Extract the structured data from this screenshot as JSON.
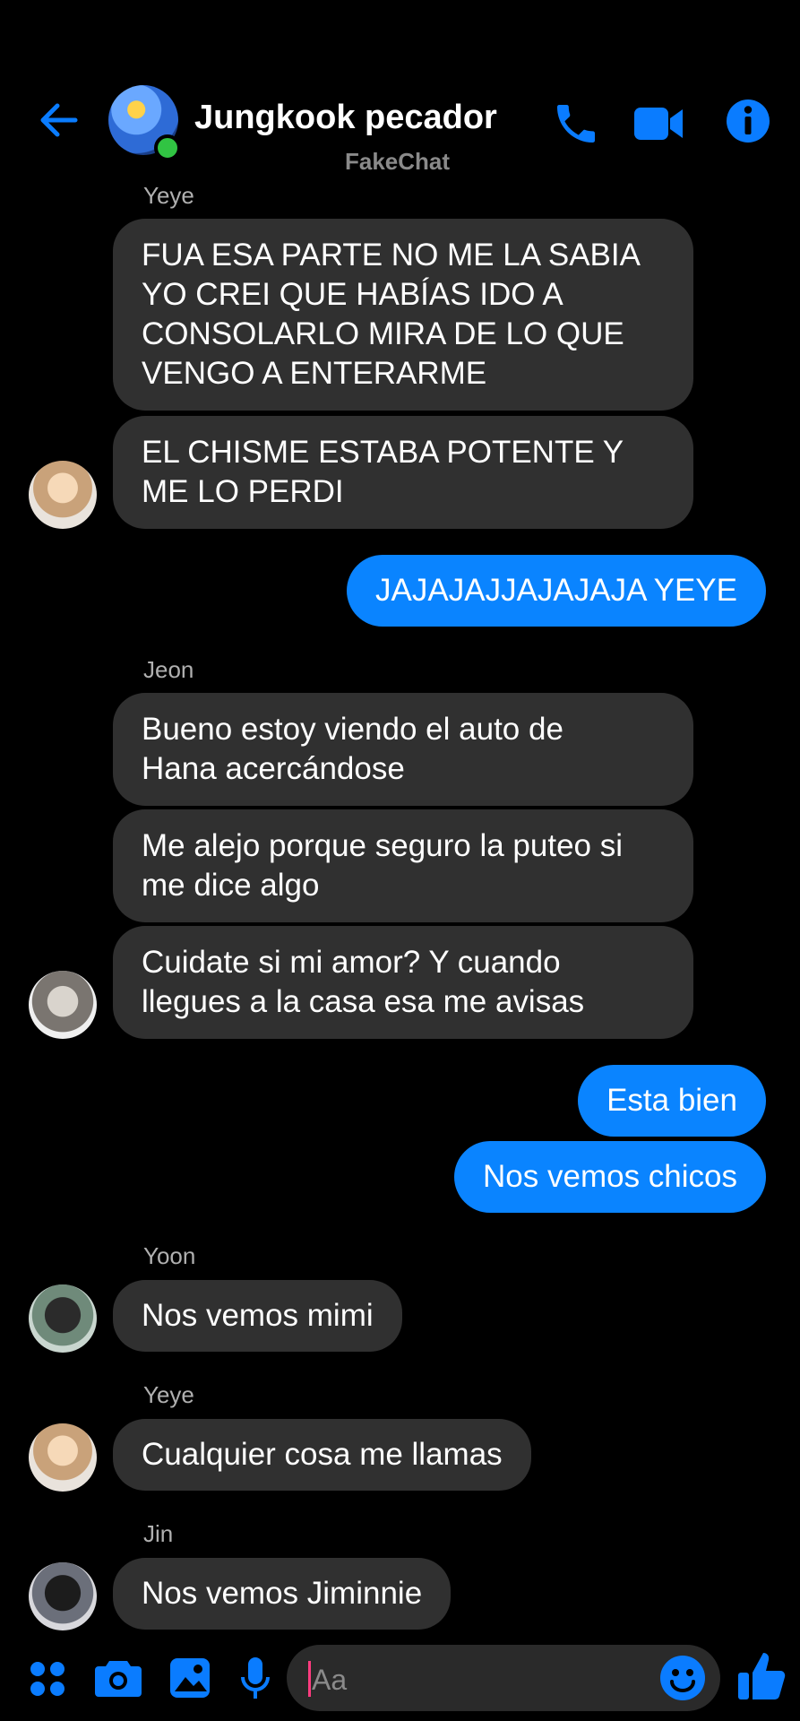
{
  "header": {
    "title": "Jungkook pecador",
    "subtitle": "FakeChat",
    "back_icon": "arrow-left-icon",
    "call_icon": "phone-icon",
    "video_icon": "video-camera-icon",
    "info_icon": "info-icon",
    "accent_color": "#0a7cff"
  },
  "messages": [
    {
      "type": "sender",
      "text": "Yeye"
    },
    {
      "type": "in",
      "lines": [
        "FUA ESA PARTE NO ME LA SABIA",
        "YO CREI QUE HABÍAS IDO A",
        "CONSOLARLO MIRA DE LO QUE",
        "VENGO A ENTERARME"
      ]
    },
    {
      "type": "in",
      "lines": [
        "EL CHISME ESTABA POTENTE Y",
        "ME LO PERDI"
      ]
    },
    {
      "type": "out",
      "text": "JAJAJAJJAJAJAJA YEYE"
    },
    {
      "type": "sender",
      "text": "Jeon"
    },
    {
      "type": "in",
      "lines": [
        "Bueno estoy viendo el auto de",
        "Hana acercándose"
      ]
    },
    {
      "type": "in",
      "lines": [
        "Me alejo porque seguro la puteo si",
        "me dice algo"
      ]
    },
    {
      "type": "in",
      "lines": [
        "Cuidate si mi amor? Y cuando",
        "llegues a la casa esa me avisas"
      ]
    },
    {
      "type": "out",
      "text": "Esta bien"
    },
    {
      "type": "out",
      "text": "Nos vemos chicos"
    },
    {
      "type": "sender",
      "text": "Yoon"
    },
    {
      "type": "in",
      "lines": [
        "Nos vemos mimi"
      ]
    },
    {
      "type": "sender",
      "text": "Yeye"
    },
    {
      "type": "in",
      "lines": [
        "Cualquier cosa me llamas"
      ]
    },
    {
      "type": "sender",
      "text": "Jin"
    },
    {
      "type": "in",
      "lines": [
        "Nos vemos Jiminnie"
      ]
    }
  ],
  "composer": {
    "placeholder": "Aa",
    "icons": [
      "menu-grid-icon",
      "camera-icon",
      "image-icon",
      "microphone-icon",
      "emoji-icon",
      "thumbs-up-icon"
    ]
  }
}
